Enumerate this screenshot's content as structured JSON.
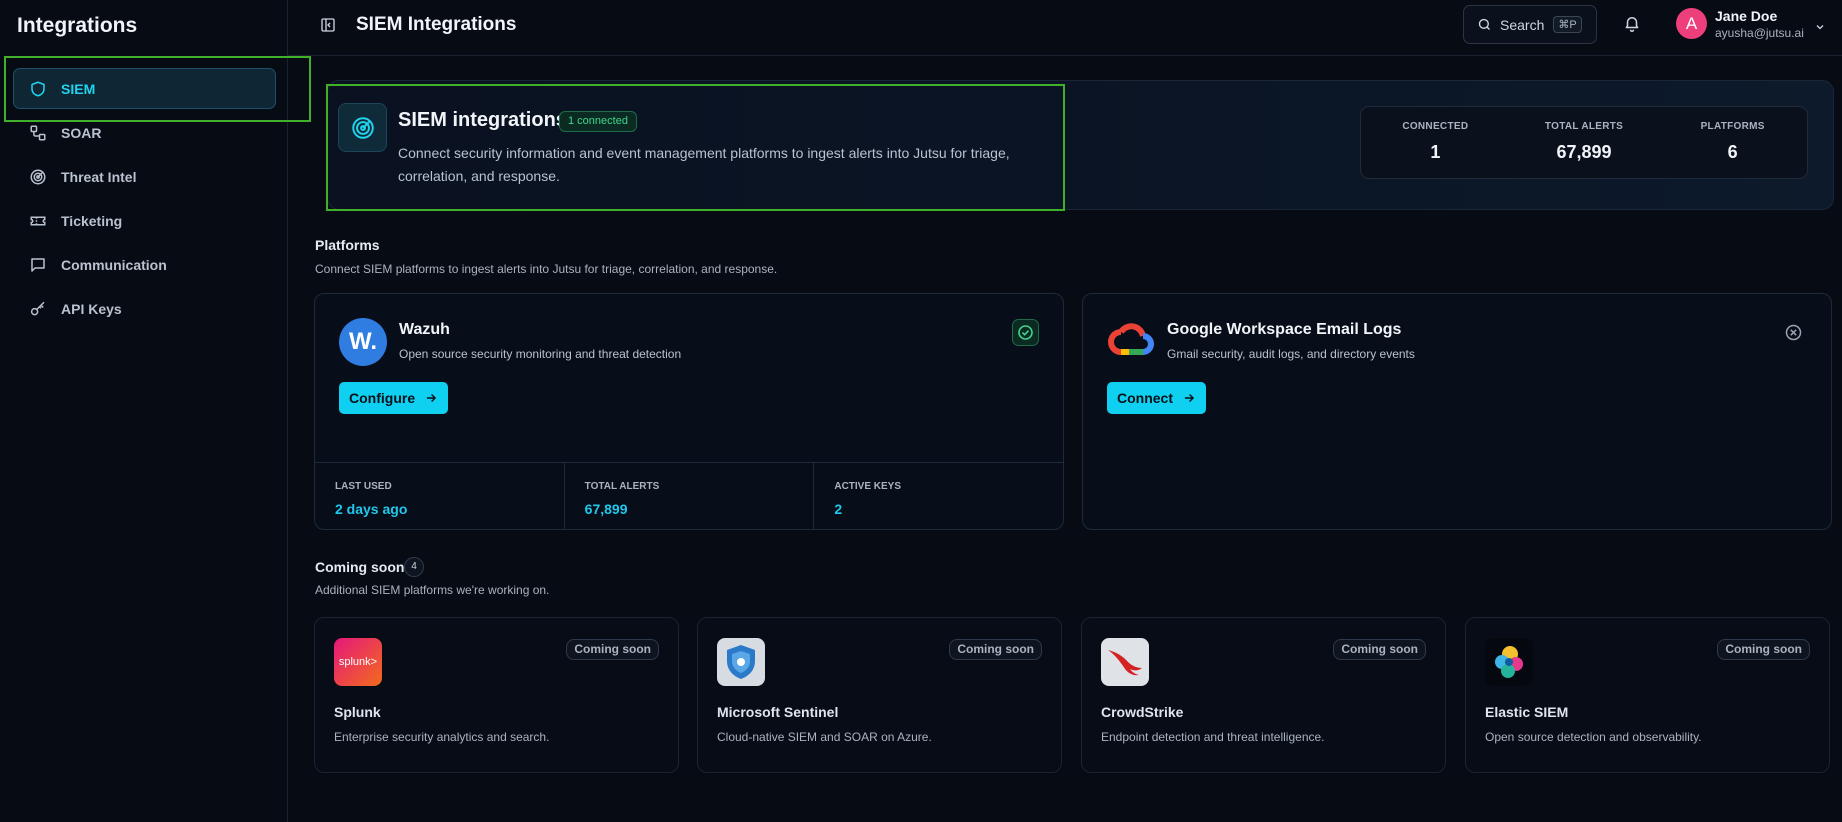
{
  "sidebar": {
    "title": "Integrations",
    "items": [
      {
        "label": "SIEM",
        "icon": "shield-icon",
        "active": true
      },
      {
        "label": "SOAR",
        "icon": "workflow-icon"
      },
      {
        "label": "Threat Intel",
        "icon": "radar-icon"
      },
      {
        "label": "Ticketing",
        "icon": "ticket-icon"
      },
      {
        "label": "Communication",
        "icon": "chat-icon"
      },
      {
        "label": "API Keys",
        "icon": "key-icon"
      }
    ]
  },
  "topbar": {
    "title": "SIEM Integrations",
    "search_label": "Search",
    "search_shortcut": "⌘P",
    "user": {
      "initial": "A",
      "name": "Jane Doe",
      "email": "ayusha@jutsu.ai"
    }
  },
  "hero": {
    "title": "SIEM integrations",
    "badge": "1 connected",
    "description": "Connect security information and event management platforms to ingest alerts into Jutsu for triage, correlation, and response.",
    "stats": [
      {
        "label": "CONNECTED",
        "value": "1"
      },
      {
        "label": "TOTAL ALERTS",
        "value": "67,899"
      },
      {
        "label": "PLATFORMS",
        "value": "6"
      }
    ]
  },
  "platforms": {
    "title": "Platforms",
    "description": "Connect SIEM platforms to ingest alerts into Jutsu for triage, correlation, and response.",
    "cards": [
      {
        "name": "Wazuh",
        "description": "Open source security monitoring and threat detection",
        "logo_text": "W.",
        "action": "Configure",
        "status": "connected",
        "footer": [
          {
            "label": "LAST USED",
            "value": "2 days ago"
          },
          {
            "label": "TOTAL ALERTS",
            "value": "67,899"
          },
          {
            "label": "ACTIVE KEYS",
            "value": "2"
          }
        ]
      },
      {
        "name": "Google Workspace Email Logs",
        "description": "Gmail security, audit logs, and directory events",
        "action": "Connect",
        "status": "disconnected"
      }
    ]
  },
  "coming_soon": {
    "title": "Coming soon",
    "count": "4",
    "description": "Additional SIEM platforms we're working on.",
    "badge": "Coming soon",
    "cards": [
      {
        "name": "Splunk",
        "description": "Enterprise security analytics and search.",
        "logo_text": "splunk>"
      },
      {
        "name": "Microsoft Sentinel",
        "description": "Cloud-native SIEM and SOAR on Azure."
      },
      {
        "name": "CrowdStrike",
        "description": "Endpoint detection and threat intelligence."
      },
      {
        "name": "Elastic SIEM",
        "description": "Open source detection and observability."
      }
    ]
  },
  "colors": {
    "accent": "#22d3ee",
    "button": "#0fd0f0",
    "success": "#3fd58c",
    "highlight": "#40b02a",
    "background": "#070b14"
  }
}
